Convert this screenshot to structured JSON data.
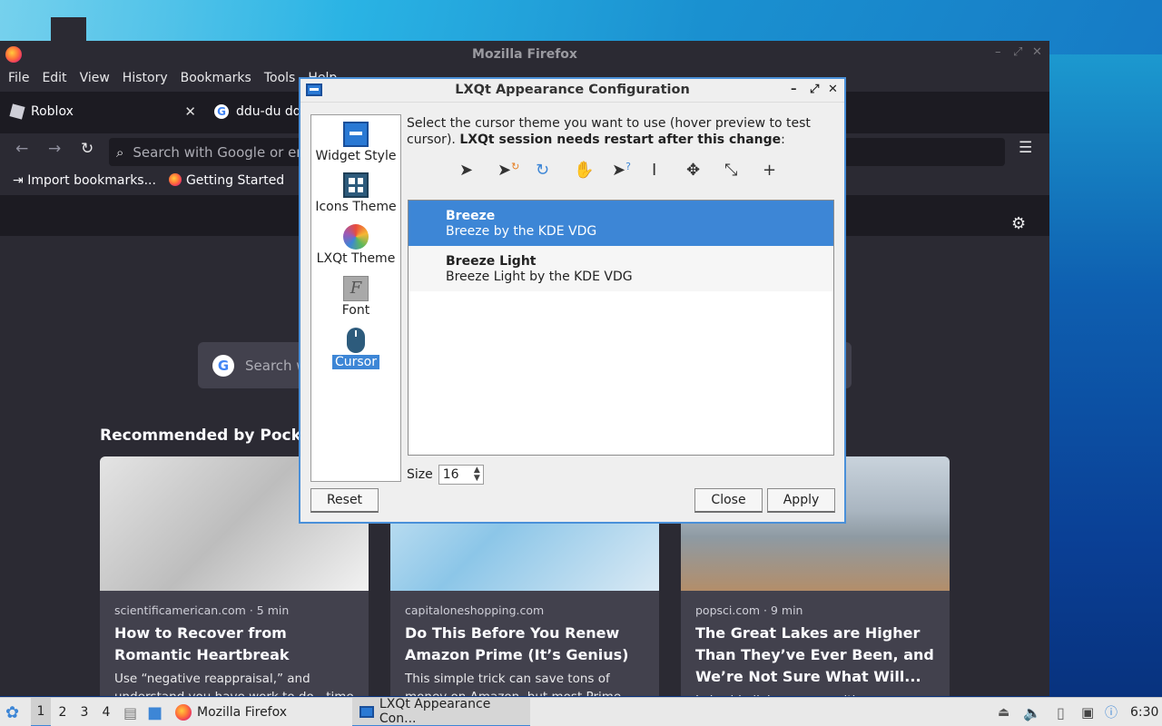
{
  "firefox": {
    "title": "Mozilla Firefox",
    "menu": [
      "File",
      "Edit",
      "View",
      "History",
      "Bookmarks",
      "Tools",
      "Help"
    ],
    "tabs": [
      {
        "label": "Roblox"
      },
      {
        "label": "ddu-du dd"
      }
    ],
    "url_placeholder": "Search with Google or er",
    "bookmarks": [
      "Import bookmarks...",
      "Getting Started"
    ],
    "search_placeholder": "Search w",
    "pocket_heading": "Recommended by Pocket",
    "cards": [
      {
        "source": "scientificamerican.com · 5 min",
        "headline": "How to Recover from Romantic Heartbreak",
        "excerpt": "Use “negative reappraisal,” and understand you have work to do—time"
      },
      {
        "source": "capitaloneshopping.com",
        "headline": "Do This Before You Renew Amazon Prime (It’s Genius)",
        "excerpt": "This simple trick can save tons of money on Amazon, but most Prime members are"
      },
      {
        "source": "popsci.com · 9 min",
        "headline": "The Great Lakes are Higher Than They’ve Ever Been, and We’re Not Sure What Will...",
        "excerpt": "Lakeside living comes with a new"
      }
    ]
  },
  "dialog": {
    "title": "LXQt Appearance Configuration",
    "sidebar": [
      {
        "label": "Widget Style",
        "icon": "widget-style-icon"
      },
      {
        "label": "Icons Theme",
        "icon": "icons-theme-icon"
      },
      {
        "label": "LXQt Theme",
        "icon": "lxqt-theme-icon"
      },
      {
        "label": "Font",
        "icon": "font-icon"
      },
      {
        "label": "Cursor",
        "icon": "cursor-icon"
      }
    ],
    "description_line1": "Select the cursor theme you want to use (hover preview to test",
    "description_line2_prefix": "cursor). ",
    "description_bold": "LXQt session needs restart after this change",
    "description_suffix": ":",
    "themes": [
      {
        "name": "Breeze",
        "desc": "Breeze by the KDE VDG"
      },
      {
        "name": "Breeze Light",
        "desc": "Breeze Light by the KDE VDG"
      }
    ],
    "size_label": "Size",
    "size_value": "16",
    "reset_label": "Reset",
    "close_label": "Close",
    "apply_label": "Apply"
  },
  "taskbar": {
    "desktops": [
      "1",
      "2",
      "3",
      "4"
    ],
    "apps": [
      "Mozilla Firefox",
      "LXQt Appearance Con..."
    ],
    "clock": "6:30"
  },
  "colors": {
    "accent": "#3d86d6",
    "firefox_bg": "#2b2a33"
  }
}
